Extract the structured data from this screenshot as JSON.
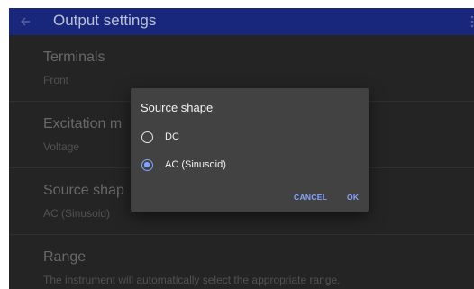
{
  "app_bar": {
    "title": "Output settings",
    "back_icon": "arrow-left-icon",
    "menu_icon": "more-vert-icon",
    "color": "#1a2a82"
  },
  "settings": [
    {
      "title": "Terminals",
      "value": "Front"
    },
    {
      "title": "Excitation m",
      "value": "Voltage"
    },
    {
      "title": "Source shap",
      "value": "AC (Sinusoid)"
    },
    {
      "title": "Range",
      "value": "The instrument will automatically select the appropriate range."
    }
  ],
  "dialog": {
    "title": "Source shape",
    "options": [
      {
        "label": "DC",
        "selected": false
      },
      {
        "label": "AC (Sinusoid)",
        "selected": true
      }
    ],
    "cancel_label": "CANCEL",
    "ok_label": "OK",
    "accent_color": "#7fa6ff"
  }
}
